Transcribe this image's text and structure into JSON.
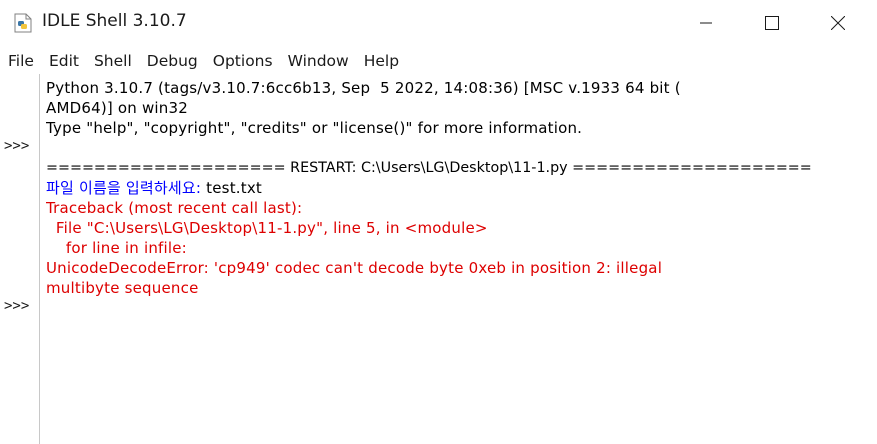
{
  "window": {
    "title": "IDLE Shell 3.10.7",
    "controls": {
      "minimize": "—",
      "maximize": "☐",
      "close": "✕"
    }
  },
  "menu": {
    "items": [
      "File",
      "Edit",
      "Shell",
      "Debug",
      "Options",
      "Window",
      "Help"
    ]
  },
  "gutter": {
    "prompts": [
      ">>>",
      ">>>"
    ]
  },
  "shell": {
    "lines": [
      {
        "text": "Python 3.10.7 (tags/v3.10.7:6cc6b13, Sep  5 2022, 14:08:36) [MSC v.1933 64 bit (",
        "color": "black"
      },
      {
        "text": "AMD64)] on win32",
        "color": "black"
      },
      {
        "text": "Type \"help\", \"copyright\", \"credits\" or \"license()\" for more information.",
        "color": "black"
      },
      {
        "text": "",
        "color": "black"
      },
      {
        "text": "==================== RESTART: C:\\Users\\LG\\Desktop\\11-1.py ====================",
        "color": "black"
      },
      {
        "prompt": "파일 이름을 입력하세요: ",
        "input": "test.txt"
      },
      {
        "text": "Traceback (most recent call last):",
        "color": "red"
      },
      {
        "text": "  File \"C:\\Users\\LG\\Desktop\\11-1.py\", line 5, in <module>",
        "color": "red"
      },
      {
        "text": "    for line in infile:",
        "color": "red"
      },
      {
        "text": "UnicodeDecodeError: 'cp949' codec can't decode byte 0xeb in position 2: illegal",
        "color": "red"
      },
      {
        "text": "multibyte sequence",
        "color": "red"
      }
    ]
  },
  "colors": {
    "stdout": "#0000ff",
    "stderr": "#dd0000",
    "text": "#000000",
    "background": "#ffffff"
  }
}
